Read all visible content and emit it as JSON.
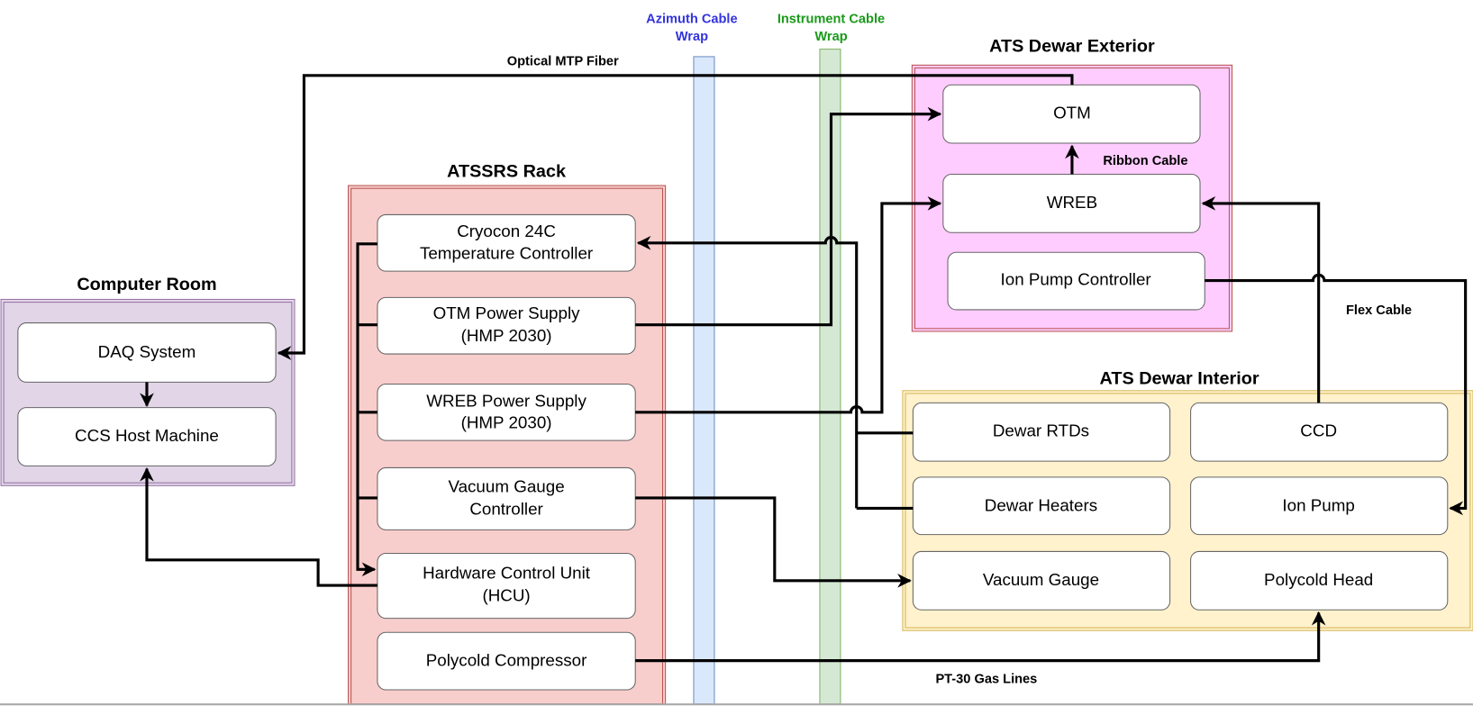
{
  "groups": {
    "computer_room": {
      "title": "Computer Room",
      "color": "#e1d5e7"
    },
    "rack": {
      "title": "ATSSRS Rack",
      "color": "#f8cecc"
    },
    "dewar_exterior": {
      "title": "ATS Dewar Exterior",
      "color": "#ffccff"
    },
    "dewar_interior": {
      "title": "ATS Dewar Interior",
      "color": "#fff2cc"
    }
  },
  "cable_wraps": {
    "azimuth": {
      "line1": "Azimuth Cable",
      "line2": "Wrap",
      "color": "#3333dd",
      "fill": "#dae8fc"
    },
    "instrument": {
      "line1": "Instrument Cable",
      "line2": "Wrap",
      "color": "#1a9a1a",
      "fill": "#d5e8d4"
    }
  },
  "nodes": {
    "daq": "DAQ System",
    "ccs": "CCS Host Machine",
    "cryocon": [
      "Cryocon 24C",
      "Temperature Controller"
    ],
    "otm_ps": [
      "OTM Power Supply",
      "(HMP 2030)"
    ],
    "wreb_ps": [
      "WREB Power Supply",
      "(HMP 2030)"
    ],
    "vac_ctrl": [
      "Vacuum Gauge",
      "Controller"
    ],
    "hcu": [
      "Hardware Control Unit",
      "(HCU)"
    ],
    "compressor": "Polycold Compressor",
    "otm": "OTM",
    "wreb": "WREB",
    "ion_ctrl": "Ion Pump Controller",
    "rtds": "Dewar RTDs",
    "ccd": "CCD",
    "heaters": "Dewar Heaters",
    "ion_pump": "Ion Pump",
    "vac_gauge": "Vacuum Gauge",
    "polycold_head": "Polycold Head"
  },
  "edge_labels": {
    "fiber": "Optical MTP Fiber",
    "ribbon": "Ribbon Cable",
    "flex": "Flex Cable",
    "gas": "PT-30 Gas Lines"
  }
}
